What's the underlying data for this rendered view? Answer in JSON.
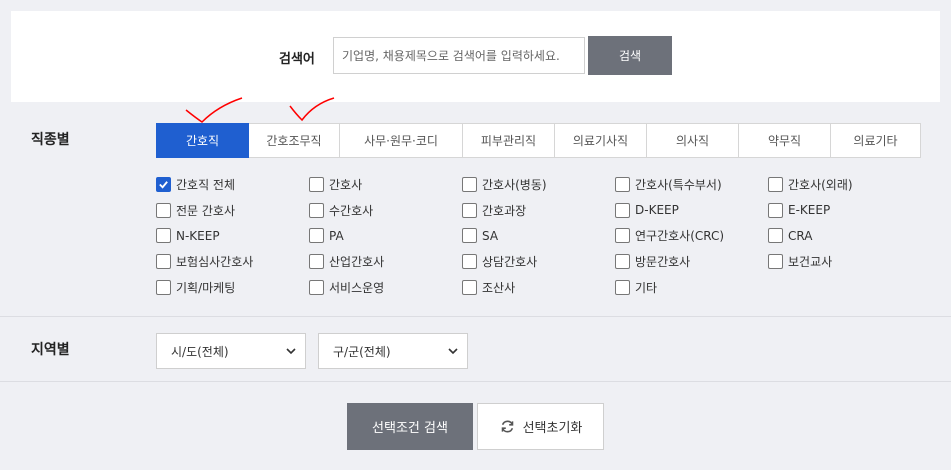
{
  "search": {
    "label": "검색어",
    "placeholder": "기업명, 채용제목으로 검색어를 입력하세요.",
    "button_label": "검색"
  },
  "job_type": {
    "section_label": "직종별",
    "tabs": [
      {
        "label": "간호직",
        "active": true
      },
      {
        "label": "간호조무직",
        "active": false
      },
      {
        "label": "사무·원무·코디",
        "active": false
      },
      {
        "label": "피부관리직",
        "active": false
      },
      {
        "label": "의료기사직",
        "active": false
      },
      {
        "label": "의사직",
        "active": false
      },
      {
        "label": "약무직",
        "active": false
      },
      {
        "label": "의료기타",
        "active": false
      }
    ],
    "options": [
      {
        "label": "간호직 전체",
        "checked": true
      },
      {
        "label": "간호사",
        "checked": false
      },
      {
        "label": "간호사(병동)",
        "checked": false
      },
      {
        "label": "간호사(특수부서)",
        "checked": false
      },
      {
        "label": "간호사(외래)",
        "checked": false
      },
      {
        "label": "전문 간호사",
        "checked": false
      },
      {
        "label": "수간호사",
        "checked": false
      },
      {
        "label": "간호과장",
        "checked": false
      },
      {
        "label": "D-KEEP",
        "checked": false
      },
      {
        "label": "E-KEEP",
        "checked": false
      },
      {
        "label": "N-KEEP",
        "checked": false
      },
      {
        "label": "PA",
        "checked": false
      },
      {
        "label": "SA",
        "checked": false
      },
      {
        "label": "연구간호사(CRC)",
        "checked": false
      },
      {
        "label": "CRA",
        "checked": false
      },
      {
        "label": "보험심사간호사",
        "checked": false
      },
      {
        "label": "산업간호사",
        "checked": false
      },
      {
        "label": "상담간호사",
        "checked": false
      },
      {
        "label": "방문간호사",
        "checked": false
      },
      {
        "label": "보건교사",
        "checked": false
      },
      {
        "label": "기획/마케팅",
        "checked": false
      },
      {
        "label": "서비스운영",
        "checked": false
      },
      {
        "label": "조산사",
        "checked": false
      },
      {
        "label": "기타",
        "checked": false
      }
    ]
  },
  "region": {
    "section_label": "지역별",
    "sido_value": "시/도(전체)",
    "gugun_value": "구/군(전체)"
  },
  "actions": {
    "search_label": "선택조건 검색",
    "reset_label": "선택초기화"
  },
  "colors": {
    "accent": "#1f5fd0",
    "button_gray": "#6d717a",
    "annotation": "#ff0000"
  }
}
